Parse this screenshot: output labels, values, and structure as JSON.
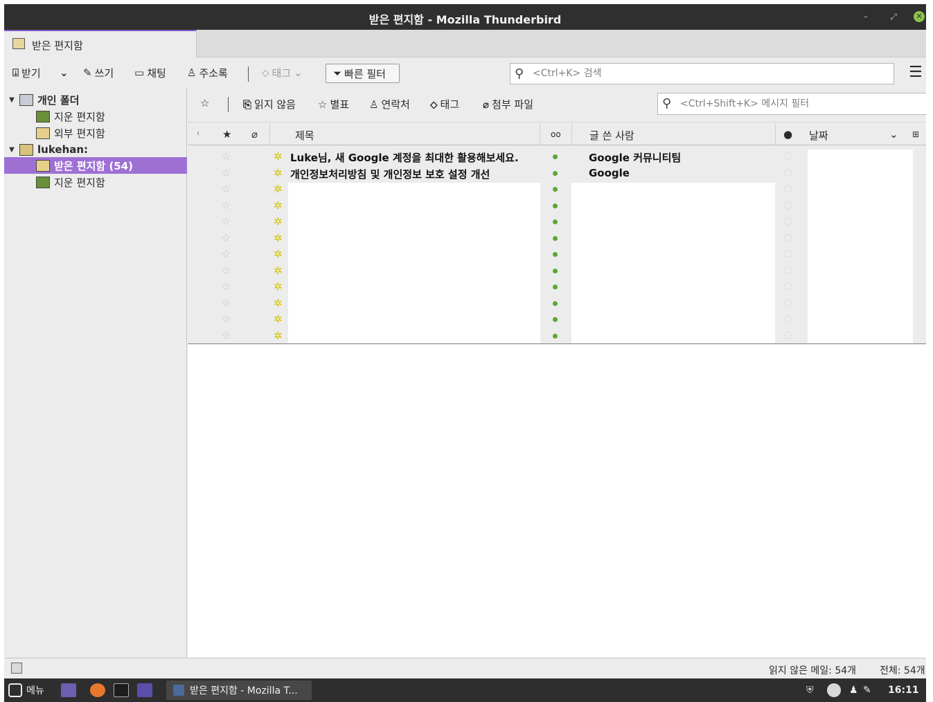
{
  "window": {
    "title": "받은 편지함 - Mozilla Thunderbird"
  },
  "tab": {
    "label": "받은 편지함"
  },
  "toolbar": {
    "get_label": "받기",
    "write_label": "쓰기",
    "chat_label": "채팅",
    "addressbook_label": "주소록",
    "tag_label": "태그",
    "quickfilter_label": "빠른 필터",
    "search_placeholder": "<Ctrl+K> 검색"
  },
  "folders": {
    "local_label": "개인 폴더",
    "local_trash_label": "지운 편지함",
    "local_outbox_label": "외부 편지함",
    "account_label": "lukehan:",
    "inbox_label": "받은 편지함 (54)",
    "trash_label": "지운 편지함"
  },
  "filterbar": {
    "unread_label": "읽지 않음",
    "starred_label": "별표",
    "contact_label": "연락처",
    "tags_label": "태그",
    "attachment_label": "첨부 파일",
    "filter_placeholder": "<Ctrl+Shift+K> 메시지 필터"
  },
  "columns": {
    "subject": "제목",
    "sender": "글 쓴 사람",
    "date": "날짜"
  },
  "messages": [
    {
      "subject": "Luke님, 새 Google 계정을 최대한 활용해보세요.",
      "sender": "Google 커뮤니티팀"
    },
    {
      "subject": "개인정보처리방침 및 개인정보 보호 설정 개선",
      "sender": "Google"
    }
  ],
  "status": {
    "unread": "읽지 않은 메일: 54개",
    "total": "전체: 54개"
  },
  "taskbar": {
    "menu_label": "메뉴",
    "window_label": "받은 편지함 - Mozilla T...",
    "clock": "16:11"
  },
  "colors": {
    "accent": "#9e70d4",
    "titlebar": "#2f2f2f",
    "read_dot": "#5aa832"
  }
}
